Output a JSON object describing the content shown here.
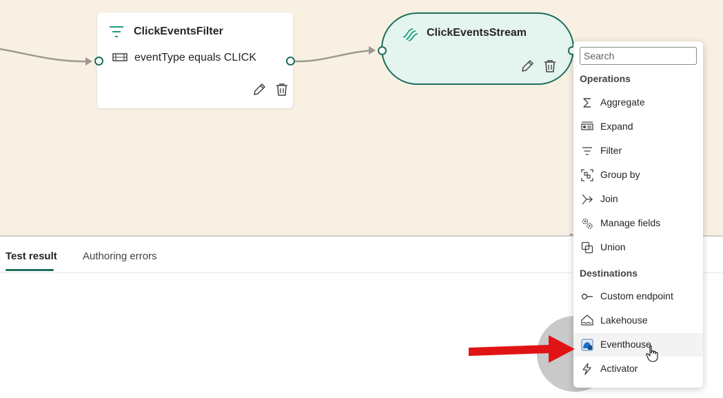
{
  "canvas": {
    "filter_node": {
      "title": "ClickEventsFilter",
      "condition": "eventType equals CLICK",
      "icon": "filter-icon"
    },
    "stream_node": {
      "title": "ClickEventsStream",
      "icon": "eventstream-icon"
    }
  },
  "tabs": [
    {
      "label": "Test result",
      "active": true
    },
    {
      "label": "Authoring errors",
      "active": false
    }
  ],
  "menu": {
    "search_placeholder": "Search",
    "operations_heading": "Operations",
    "operations": [
      {
        "label": "Aggregate",
        "icon": "sigma-icon"
      },
      {
        "label": "Expand",
        "icon": "expand-icon"
      },
      {
        "label": "Filter",
        "icon": "filter-icon"
      },
      {
        "label": "Group by",
        "icon": "group-by-icon"
      },
      {
        "label": "Join",
        "icon": "join-icon"
      },
      {
        "label": "Manage fields",
        "icon": "manage-fields-icon"
      },
      {
        "label": "Union",
        "icon": "union-icon"
      }
    ],
    "destinations_heading": "Destinations",
    "destinations": [
      {
        "label": "Custom endpoint",
        "icon": "custom-endpoint-icon"
      },
      {
        "label": "Lakehouse",
        "icon": "lakehouse-icon"
      },
      {
        "label": "Eventhouse",
        "icon": "eventhouse-icon",
        "hovered": true
      },
      {
        "label": "Activator",
        "icon": "lightning-icon"
      }
    ]
  },
  "colors": {
    "canvas_bg": "#f9f0e4",
    "node_accent": "#1c6e5b",
    "stream_fill": "#e4f4ef",
    "annotation_arrow": "#e01414"
  }
}
